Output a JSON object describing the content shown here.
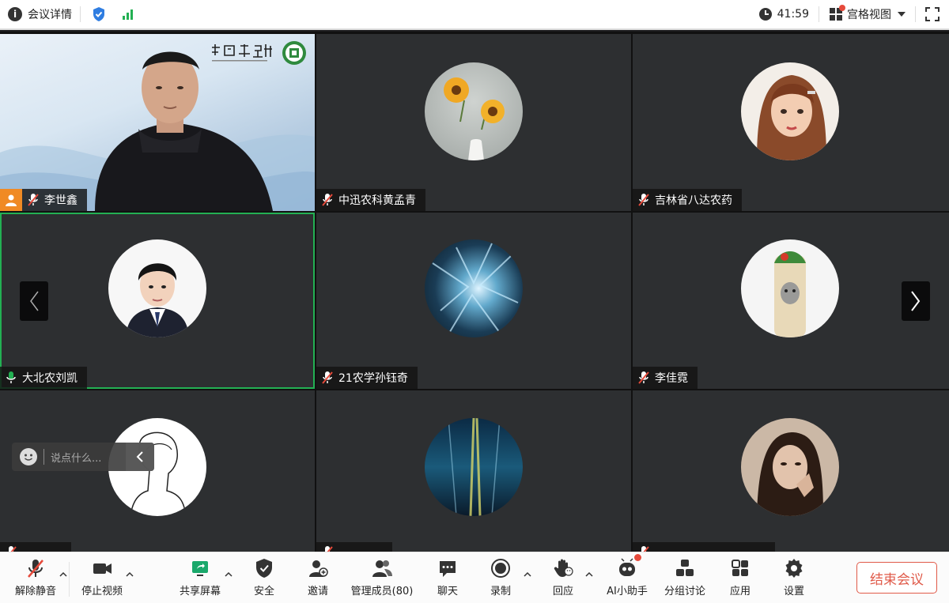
{
  "topbar": {
    "meeting_details": "会议详情",
    "timer": "41:59",
    "view_mode": "宫格视图"
  },
  "participants": [
    {
      "name": "李世鑫",
      "mic": "muted",
      "badge": "host-person"
    },
    {
      "name": "中迅农科黄孟青",
      "mic": "muted"
    },
    {
      "name": "吉林省八达农药",
      "mic": "muted"
    },
    {
      "name": "大北农刘凯",
      "mic": "active"
    },
    {
      "name": "21农学孙钰奇",
      "mic": "muted"
    },
    {
      "name": "李佳霓",
      "mic": "muted"
    },
    {
      "name": "",
      "mic": "muted"
    },
    {
      "name": "",
      "mic": "muted"
    },
    {
      "name": "",
      "mic": "muted"
    }
  ],
  "chat": {
    "placeholder": "说点什么..."
  },
  "toolbar": {
    "unmute": "解除静音",
    "stop_video": "停止视频",
    "share_screen": "共享屏幕",
    "security": "安全",
    "invite": "邀请",
    "manage_members": "管理成员(80)",
    "chat": "聊天",
    "record": "录制",
    "reactions": "回应",
    "ai_assistant": "AI小助手",
    "breakout": "分组讨论",
    "apps": "应用",
    "settings": "设置",
    "end_meeting": "结束会议"
  },
  "colors": {
    "active_speaker": "#23b053",
    "muted_mic": "#e64a3b",
    "end_button": "#e05a49",
    "share_green": "#1aa86b"
  }
}
